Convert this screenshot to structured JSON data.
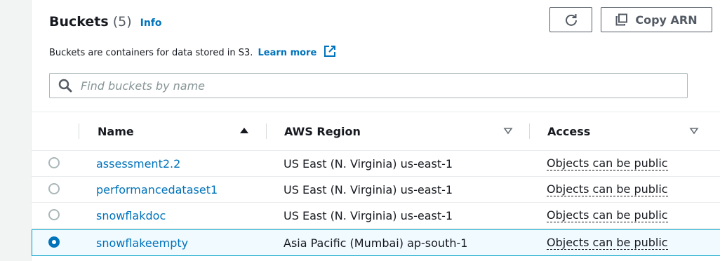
{
  "header": {
    "title": "Buckets",
    "count": "(5)",
    "info_link": "Info",
    "description": "Buckets are containers for data stored in S3.",
    "learn_more": "Learn more"
  },
  "actions": {
    "refresh_icon": "refresh-icon",
    "copy_arn_label": "Copy ARN",
    "copy_icon": "copy-icon"
  },
  "search": {
    "placeholder": "Find buckets by name",
    "value": ""
  },
  "table": {
    "columns": [
      {
        "label": "Name",
        "sort": "ascending"
      },
      {
        "label": "AWS Region",
        "sort": "none"
      },
      {
        "label": "Access",
        "sort": "none"
      }
    ],
    "rows": [
      {
        "name": "assessment2.2",
        "region": "US East (N. Virginia) us-east-1",
        "access": "Objects can be public",
        "selected": false
      },
      {
        "name": "performancedataset1",
        "region": "US East (N. Virginia) us-east-1",
        "access": "Objects can be public",
        "selected": false
      },
      {
        "name": "snowflakdoc",
        "region": "US East (N. Virginia) us-east-1",
        "access": "Objects can be public",
        "selected": false
      },
      {
        "name": "snowflakeempty",
        "region": "Asia Pacific (Mumbai) ap-south-1",
        "access": "Objects can be public",
        "selected": true
      }
    ]
  },
  "colors": {
    "link": "#0073bb",
    "selected_row_bg": "#f1faff",
    "selected_row_border": "#00a1c9"
  }
}
